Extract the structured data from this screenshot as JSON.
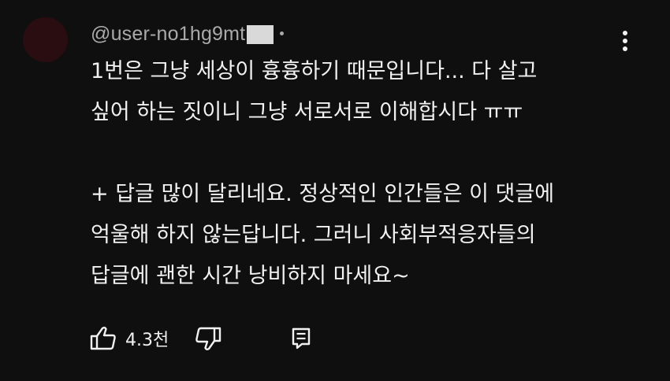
{
  "comment": {
    "author": "@user-no1hg9mt",
    "separator": "•",
    "lines": [
      "1번은 그냥 세상이 흉흉하기 때문입니다... 다 살고",
      "싶어 하는 짓이니 그냥 서로서로 이해합시다 ㅠㅠ",
      "",
      "+ 답글 많이 달리네요. 정상적인 인간들은 이 댓글에",
      "억울해 하지 않는답니다. 그러니 사회부적응자들의",
      "답글에 괜한 시간 낭비하지 마세요~"
    ],
    "like_count": "4.3천"
  },
  "icons": {
    "like": "thumbs-up-icon",
    "dislike": "thumbs-down-icon",
    "reply": "reply-icon",
    "more": "more-vertical-icon"
  },
  "colors": {
    "background": "#0f0f0f",
    "text": "#f1f1f1",
    "secondary_text": "#aaaaaa",
    "avatar": "#2a0d10"
  }
}
